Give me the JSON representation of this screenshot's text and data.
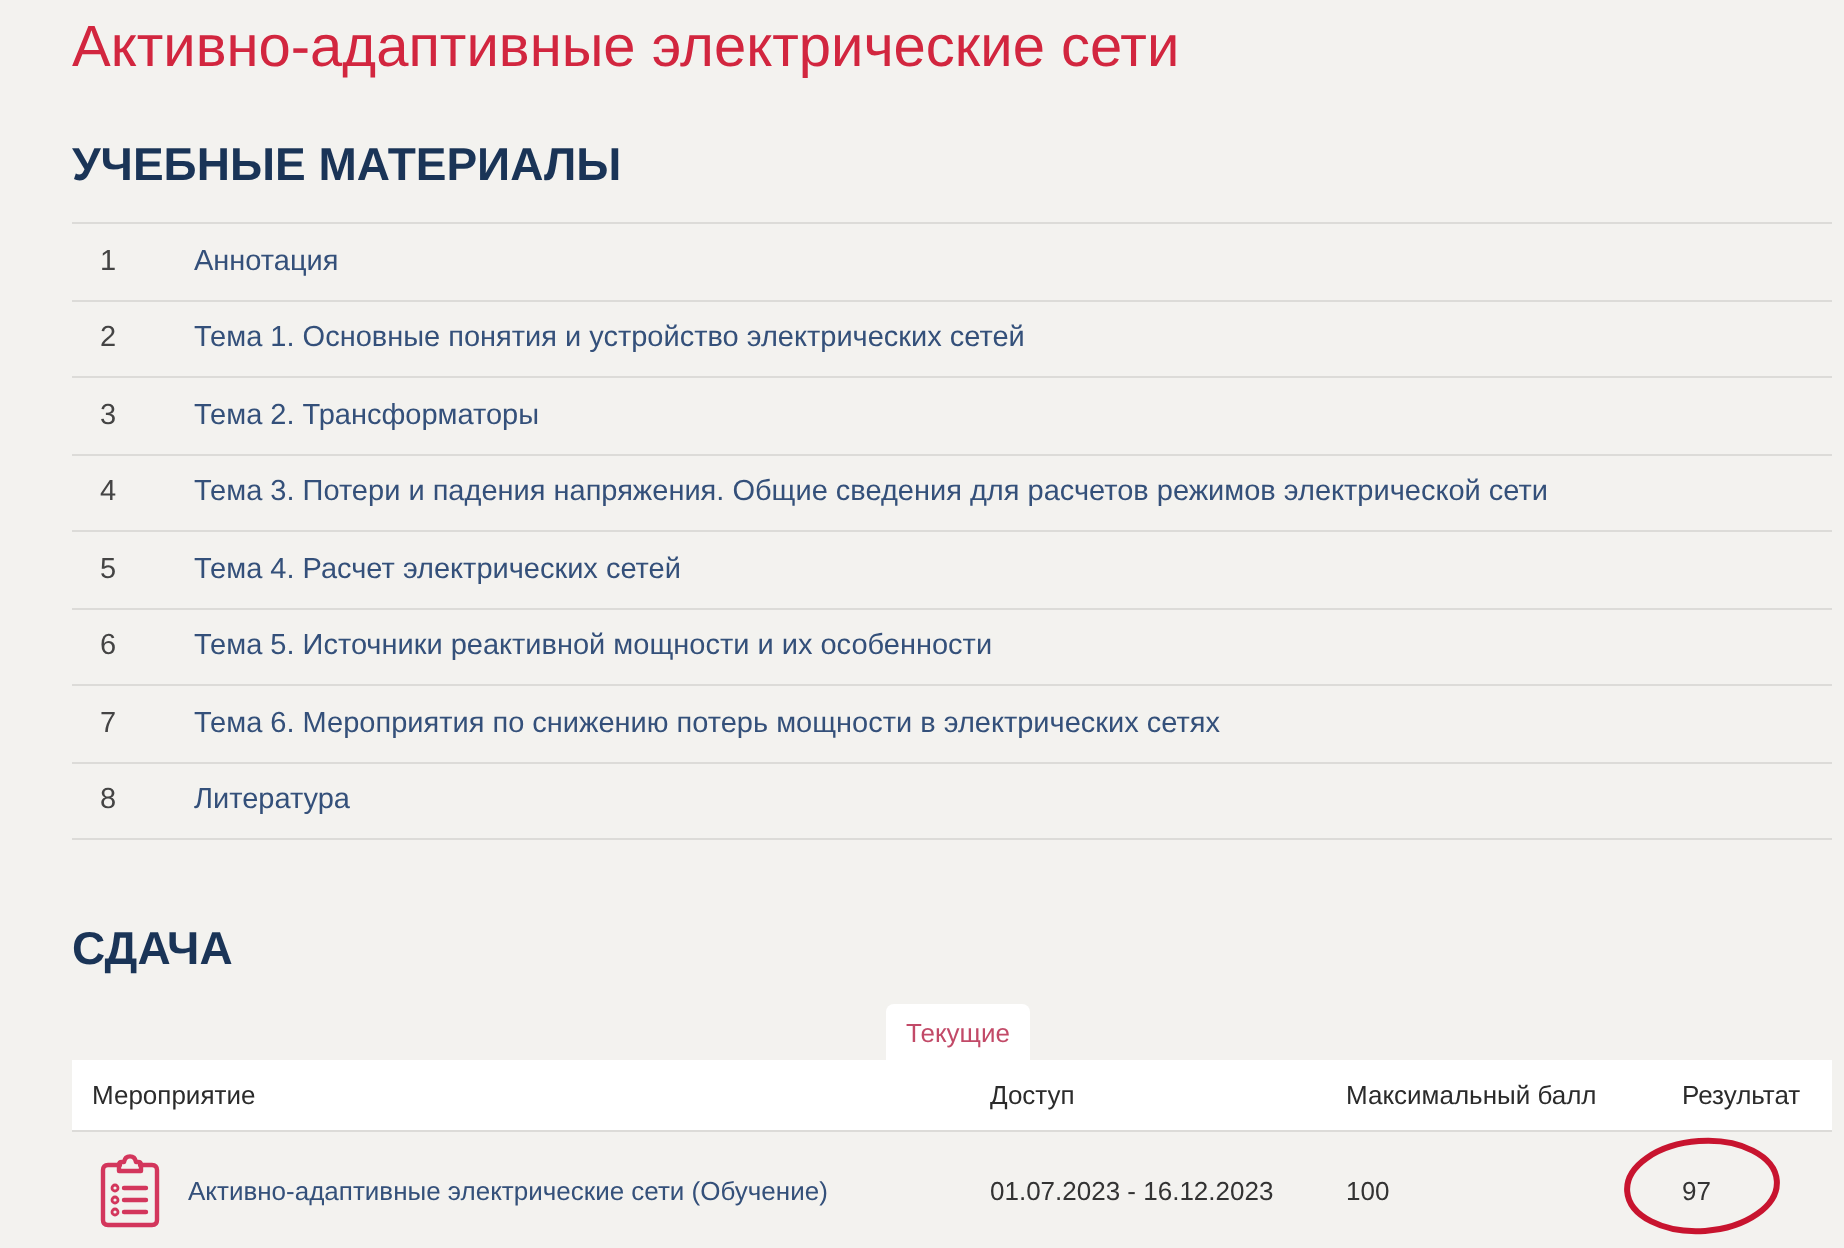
{
  "page": {
    "title": "Активно-адаптивные электрические сети"
  },
  "materials": {
    "heading": "УЧЕБНЫЕ МАТЕРИАЛЫ",
    "items": [
      {
        "number": "1",
        "title": "Аннотация"
      },
      {
        "number": "2",
        "title": "Тема 1. Основные понятия и устройство электрических сетей"
      },
      {
        "number": "3",
        "title": "Тема 2. Трансформаторы"
      },
      {
        "number": "4",
        "title": "Тема 3. Потери и падения напряжения. Общие сведения для расчетов режимов электрической сети"
      },
      {
        "number": "5",
        "title": "Тема 4. Расчет электрических сетей"
      },
      {
        "number": "6",
        "title": "Тема 5. Источники реактивной мощности и их особенности"
      },
      {
        "number": "7",
        "title": "Тема 6. Мероприятия по снижению потерь мощности в электрических сетях"
      },
      {
        "number": "8",
        "title": "Литература"
      }
    ]
  },
  "submission": {
    "heading": "СДАЧА",
    "tabs": [
      {
        "label": "Текущие",
        "selected": true
      }
    ],
    "table": {
      "columns": [
        "Мероприятие",
        "Доступ",
        "Максимальный балл",
        "Результат"
      ],
      "rows": [
        {
          "activity": "Активно-адаптивные электрические сети (Обучение)",
          "access": "01.07.2023 - 16.12.2023",
          "max_score": "100",
          "result": "97",
          "result_circled": true
        }
      ]
    }
  }
}
